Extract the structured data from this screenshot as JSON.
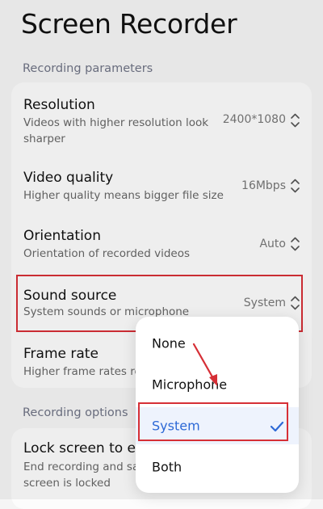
{
  "page": {
    "title": "Screen Recorder"
  },
  "sections": {
    "recording_parameters": "Recording parameters",
    "recording_options": "Recording options"
  },
  "settings": [
    {
      "title": "Resolution",
      "description": "Videos with higher resolution look sharper",
      "value": "2400*1080"
    },
    {
      "title": "Video quality",
      "description": "Higher quality means bigger file size",
      "value": "16Mbps"
    },
    {
      "title": "Orientation",
      "description": "Orientation of recorded videos",
      "value": "Auto"
    },
    {
      "title": "Sound source",
      "description": "System sounds or microphone",
      "value": "System"
    },
    {
      "title": "Frame rate",
      "description": "Higher frame rates re",
      "value": ""
    }
  ],
  "options": [
    {
      "title": "Lock screen to er",
      "description": "End recording and sa screen is locked"
    }
  ],
  "dropdown": {
    "items": [
      {
        "label": "None",
        "selected": false
      },
      {
        "label": "Microphone",
        "selected": false
      },
      {
        "label": "System",
        "selected": true
      },
      {
        "label": "Both",
        "selected": false
      }
    ]
  },
  "colors": {
    "accent": "#2d69d6",
    "annotation": "#d62f36",
    "background": "#f5f5f5",
    "card": "#fcfcfc"
  },
  "icons": {
    "row_control": "chevron-up-down-icon",
    "selected_mark": "check-icon"
  }
}
